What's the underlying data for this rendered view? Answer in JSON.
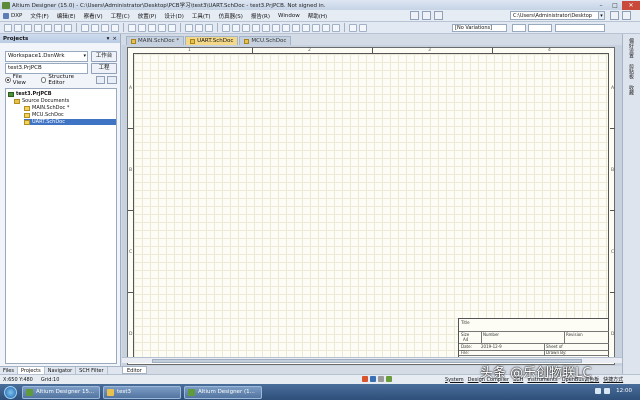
{
  "window": {
    "title": "Altium Designer (15.0) - C:\\Users\\Administrator\\Desktop\\PCB学习\\test3\\UART.SchDoc - test3.PrjPCB. Not signed in.",
    "minimize_glyph": "–",
    "maximize_glyph": "□",
    "close_glyph": "✕"
  },
  "menubar": {
    "items": [
      "DXP",
      "文件(F)",
      "编辑(E)",
      "察看(V)",
      "工程(C)",
      "放置(P)",
      "设计(D)",
      "工具(T)",
      "仿真器(S)",
      "报告(R)",
      "Window",
      "帮助(H)"
    ],
    "path": "C:\\Users\\Administrator\\Desktop",
    "dropdown_glyph": "▾"
  },
  "toolbar": {
    "variations": "[No Variations]"
  },
  "panel": {
    "title": "Projects",
    "controls": [
      "▾",
      "×"
    ],
    "workspace_value": "Workspace1.DsnWrk",
    "workspace_button": "工作台",
    "project_value": "test3.PrjPCB",
    "project_button": "工程",
    "view_file": "File View",
    "view_structure": "Structure Editor",
    "tree": {
      "project": "test3.PrjPCB",
      "folder": "Source Documents",
      "docs": [
        "MAIN.SchDoc *",
        "MCU.SchDoc",
        "UART.SchDoc"
      ]
    },
    "tabs": [
      "Files",
      "Projects",
      "Navigator",
      "SCH Filter"
    ]
  },
  "doc_tabs": [
    "MAIN.SchDoc *",
    "UART.SchDoc",
    "MCU.SchDoc"
  ],
  "sheet": {
    "columns": [
      "1",
      "2",
      "3",
      "4"
    ],
    "rows": [
      "A",
      "B",
      "C",
      "D"
    ],
    "title_block": {
      "title": "Title",
      "size": "Size",
      "size_value": "A4",
      "number": "Number",
      "revision": "Revision",
      "date": "Date:",
      "date_value": "2019-12-9",
      "sheet": "Sheet  of",
      "file": "File:",
      "drawn_by": "Drawn By:"
    }
  },
  "editor_tab": "Editor",
  "right_strip": [
    "偏好设置",
    "剪贴板",
    "收藏"
  ],
  "status": {
    "coords": "X:650 Y:480",
    "grid": "Grid:10",
    "right": [
      "System",
      "Design Compiler",
      "SCH",
      "Instruments",
      "OpenBus调色板",
      "快捷方式"
    ]
  },
  "taskbar": {
    "items": [
      "Altium Designer 15...",
      "test3",
      "Altium Designer (1..."
    ],
    "clock": "12:00"
  },
  "watermark": "头条 @乐创物联LC"
}
